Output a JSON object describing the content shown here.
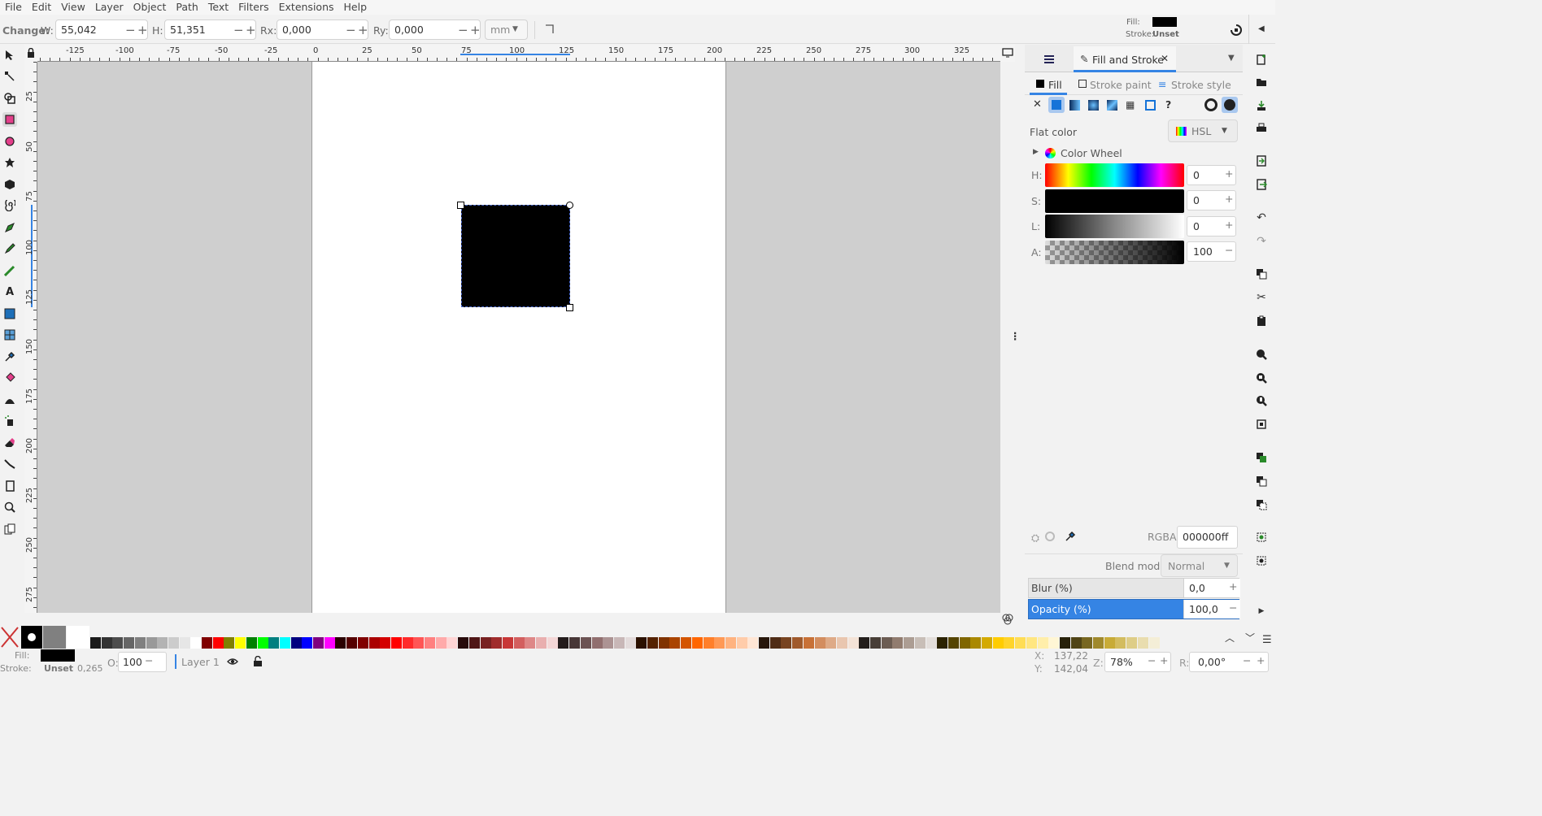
{
  "menu": [
    "File",
    "Edit",
    "View",
    "Layer",
    "Object",
    "Path",
    "Text",
    "Filters",
    "Extensions",
    "Help"
  ],
  "toolbar": {
    "change_label": "Change:",
    "w_label": "W:",
    "w_value": "55,042",
    "h_label": "H:",
    "h_value": "51,351",
    "rx_label": "Rx:",
    "rx_value": "0,000",
    "ry_label": "Ry:",
    "ry_value": "0,000",
    "unit": "mm",
    "fill_label": "Fill:",
    "stroke_label": "Stroke:",
    "stroke_value": "Unset"
  },
  "ruler": {
    "h_labels": [
      "-125",
      "-100",
      "-75",
      "-50",
      "-25",
      "0",
      "25",
      "50",
      "75",
      "100",
      "125",
      "150",
      "175",
      "200",
      "225",
      "250",
      "275",
      "300",
      "325"
    ],
    "v_labels": [
      "25",
      "50",
      "75",
      "100",
      "125",
      "150",
      "175",
      "200",
      "225",
      "250",
      "275"
    ]
  },
  "panel": {
    "tab_label": "Fill and Stroke",
    "subtabs": [
      "Fill",
      "Stroke paint",
      "Stroke style"
    ],
    "flat_color": "Flat color",
    "color_mode": "HSL",
    "color_wheel": "Color Wheel",
    "channels": [
      {
        "label": "H:",
        "value": "0"
      },
      {
        "label": "S:",
        "value": "0"
      },
      {
        "label": "L:",
        "value": "0"
      },
      {
        "label": "A:",
        "value": "100"
      }
    ],
    "rgba_label": "RGBA:",
    "rgba_value": "000000ff",
    "blend_label": "Blend mode:",
    "blend_value": "Normal",
    "blur_label": "Blur (%)",
    "blur_value": "0,0",
    "opacity_label": "Opacity (%)",
    "opacity_value": "100,0"
  },
  "status": {
    "fill_label": "Fill:",
    "stroke_label": "Stroke:",
    "stroke_value": "Unset",
    "stroke_width": "0,265",
    "o_label": "O:",
    "o_value": "100",
    "layer": "Layer 1",
    "x_label": "X:",
    "x_value": "137,22",
    "y_label": "Y:",
    "y_value": "142,04",
    "z_label": "Z:",
    "zoom": "78%",
    "r_label": "R:",
    "rotation": "0,00°"
  },
  "colors": {
    "accent": "#3584e4",
    "fill": "#000000"
  },
  "palette": [
    "#1a1a1a",
    "#333333",
    "#4d4d4d",
    "#666666",
    "#808080",
    "#999999",
    "#b3b3b3",
    "#cccccc",
    "#e6e6e6",
    "#ffffff",
    "#800000",
    "#ff0000",
    "#808000",
    "#ffff00",
    "#008000",
    "#00ff00",
    "#008080",
    "#00ffff",
    "#000080",
    "#0000ff",
    "#800080",
    "#ff00ff",
    "#2b0000",
    "#550000",
    "#800000",
    "#aa0000",
    "#d40000",
    "#ff0000",
    "#ff2a2a",
    "#ff5555",
    "#ff8080",
    "#ffaaaa",
    "#ffd5d5",
    "#280b0b",
    "#501616",
    "#782121",
    "#a02c2c",
    "#c83737",
    "#d35f5f",
    "#de8787",
    "#e9afaf",
    "#f4d7d7",
    "#241c1c",
    "#483737",
    "#6c5353",
    "#916f6f",
    "#ac9393",
    "#c8b7b7",
    "#e3dbdb",
    "#2b1100",
    "#552200",
    "#803300",
    "#aa4400",
    "#d45500",
    "#ff6600",
    "#ff7f2a",
    "#ff9955",
    "#ffb380",
    "#ffccaa",
    "#ffe6d5",
    "#28170b",
    "#502d16",
    "#784421",
    "#a05a2c",
    "#c87137",
    "#d38d5f",
    "#deaa87",
    "#e9c6af",
    "#f4e3d7",
    "#241f1c",
    "#483e37",
    "#6c5d53",
    "#917c6f",
    "#ac9d93",
    "#c8beb7",
    "#e3dedb",
    "#2b2200",
    "#554400",
    "#806600",
    "#aa8800",
    "#d4aa00",
    "#ffcc00",
    "#ffd42a",
    "#ffdd55",
    "#ffe680",
    "#ffeeaa",
    "#fff6d5",
    "#28220b",
    "#504416",
    "#786721",
    "#a0892c",
    "#c8ab37",
    "#d3bc5f",
    "#decd87",
    "#e9ddaf",
    "#f4eed7"
  ]
}
